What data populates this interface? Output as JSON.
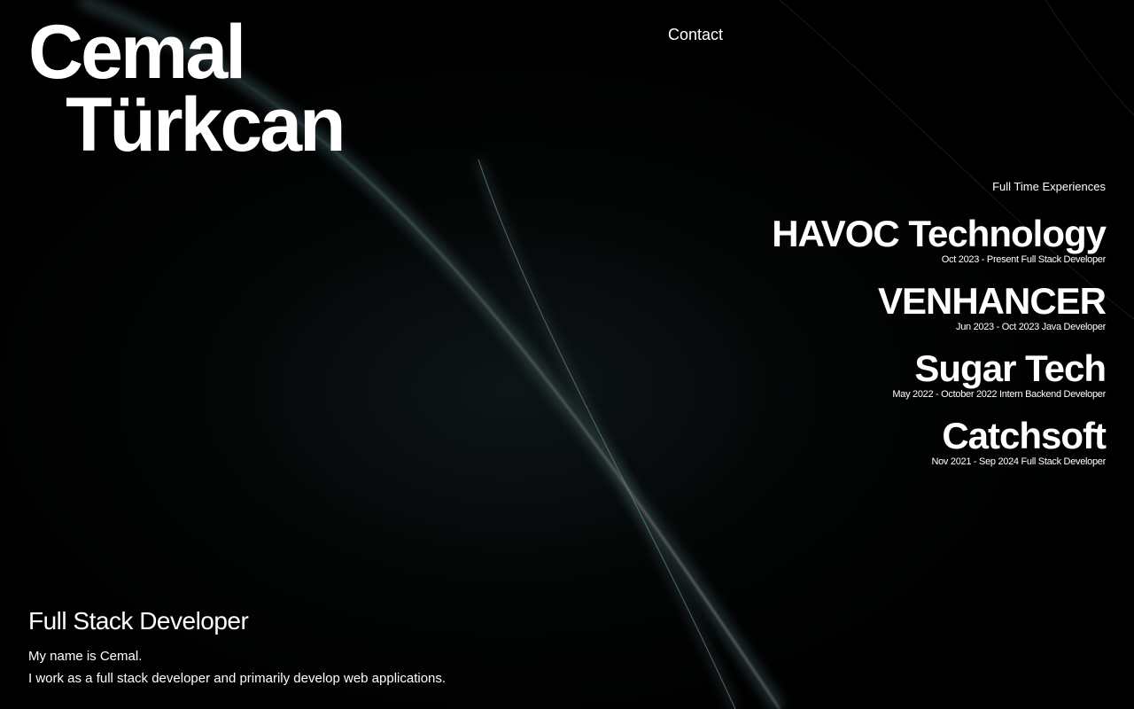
{
  "header": {
    "name_line1": "Cemal",
    "name_line2": "Türkcan",
    "contact_label": "Contact"
  },
  "experiences": {
    "heading": "Full Time Experiences",
    "items": [
      {
        "company": "HAVOC Technology",
        "dates": "Oct 2023 - Present",
        "role": "Full Stack Developer"
      },
      {
        "company": "VENHANCER",
        "dates": "Jun 2023 - Oct 2023",
        "role": "Java Developer"
      },
      {
        "company": "Sugar Tech",
        "dates": "May 2022 - October 2022",
        "role": "Intern Backend Developer"
      },
      {
        "company": "Catchsoft",
        "dates": "Nov 2021 - Sep 2024",
        "role": "Full Stack Developer"
      }
    ]
  },
  "intro": {
    "title": "Full Stack Developer",
    "line1": "My name is Cemal.",
    "line2": "I work as a full stack developer and primarily develop web applications."
  },
  "colors": {
    "background": "#000000",
    "text": "#ffffff",
    "light_streak": "#5a7a80"
  }
}
